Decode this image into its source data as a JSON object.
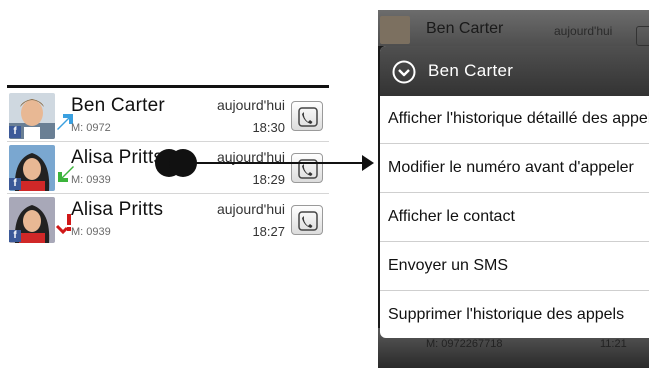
{
  "call_log": {
    "entries": [
      {
        "name": "Ben  Carter",
        "number": "M: 0972",
        "date": "aujourd'hui",
        "time": "18:30",
        "avatar": "photo-man",
        "status_icon": "outgoing-call-icon"
      },
      {
        "name": "Alisa Pritts",
        "number": "M: 0939",
        "date": "aujourd'hui",
        "time": "18:29",
        "avatar": "photo-woman",
        "status_icon": "incoming-call-icon"
      },
      {
        "name": "Alisa Pritts",
        "number": "M: 0939",
        "date": "aujourd'hui",
        "time": "18:27",
        "avatar": "photo-woman",
        "status_icon": "missed-call-icon"
      }
    ],
    "badge_label": "f"
  },
  "context_menu": {
    "title": "Ben  Carter",
    "items": [
      "Afficher l'historique détaillé des appels",
      "Modifier le numéro avant d'appeler",
      "Afficher le contact",
      "Envoyer un SMS",
      "Supprimer l'historique des appels"
    ]
  },
  "background_list": {
    "top_name": "Ben  Carter",
    "top_date": "aujourd'hui",
    "bottom_number": "M: 0972267718",
    "bottom_time": "11:21"
  },
  "colors": {
    "accent_outgoing": "#3aa0e0",
    "accent_incoming": "#3cb43c",
    "accent_missed": "#d01818",
    "facebook": "#3b5998",
    "menu_header": "#404040"
  }
}
